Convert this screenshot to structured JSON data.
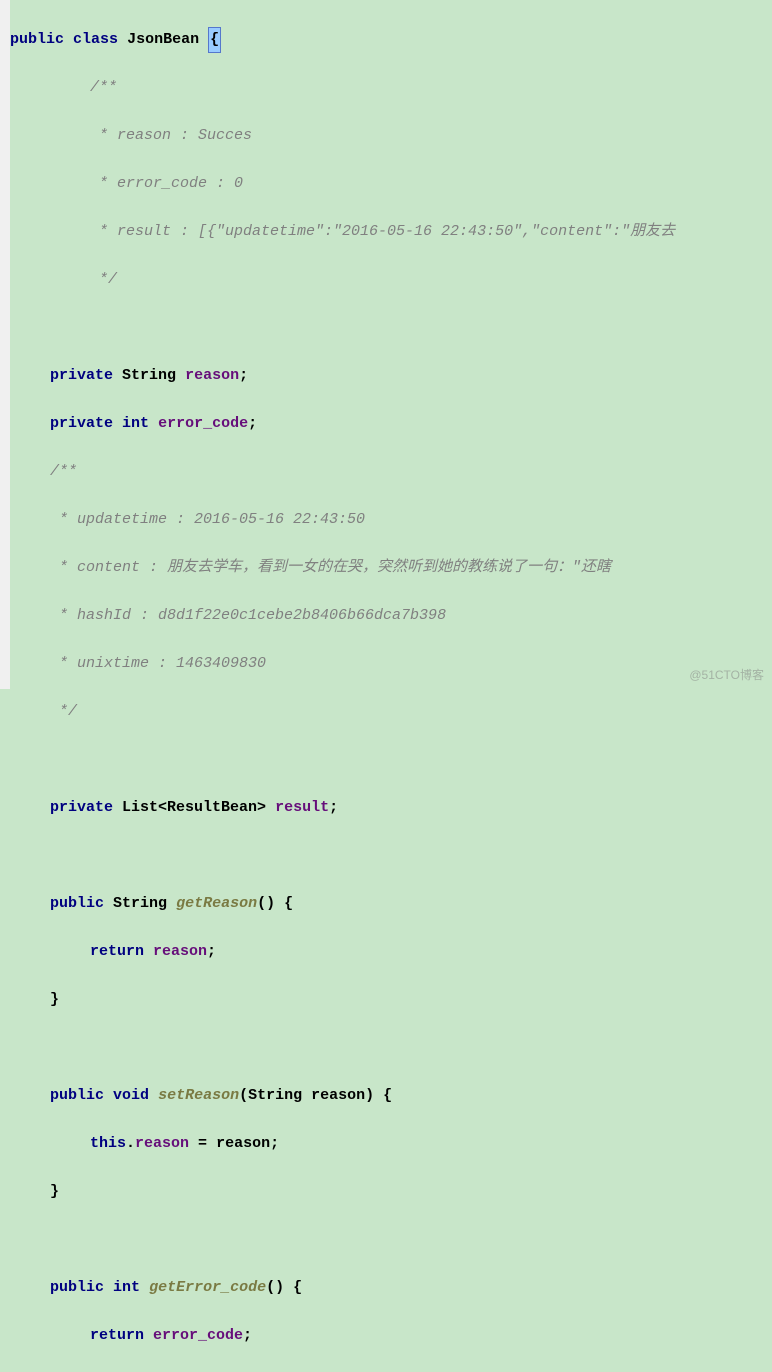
{
  "watermark": "@51CTO博客",
  "code": {
    "l1_public": "public",
    "l1_class": "class",
    "l1_name": "JsonBean",
    "l1_brace": "{",
    "l2": "/**",
    "l3": " * reason : Succes",
    "l4": " * error_code : 0",
    "l5": " * result : [{\"updatetime\":\"2016-05-16 22:43:50\",\"content\":\"朋友去",
    "l6": " */",
    "l8_private": "private",
    "l8_type": "String",
    "l8_name": "reason",
    "l8_semi": ";",
    "l9_private": "private",
    "l9_type": "int",
    "l9_name": "error_code",
    "l9_semi": ";",
    "l10": "/**",
    "l11": " * updatetime : 2016-05-16 22:43:50",
    "l12": " * content : 朋友去学车，看到一女的在哭，突然听到她的教练说了一句：\"还瞎",
    "l13": " * hashId : d8d1f22e0c1cebe2b8406b66dca7b398",
    "l14": " * unixtime : 1463409830",
    "l15": " */",
    "l17_private": "private",
    "l17_type": "List<ResultBean>",
    "l17_name": "result",
    "l17_semi": ";",
    "l19_public": "public",
    "l19_type": "String",
    "l19_method": "getReason",
    "l19_params": "()",
    "l19_brace": " {",
    "l20_return": "return",
    "l20_name": "reason",
    "l20_semi": ";",
    "l21_brace": "}",
    "l23_public": "public",
    "l23_type": "void",
    "l23_method": "setReason",
    "l23_params_open": "(",
    "l23_param_type": "String",
    "l23_param_name": " reason",
    "l23_params_close": ")",
    "l23_brace": " {",
    "l24_this": "this",
    "l24_dot": ".",
    "l24_name": "reason",
    "l24_eq": " = ",
    "l24_val": "reason;",
    "l25_brace": "}",
    "l27_public": "public",
    "l27_type": "int",
    "l27_method": "getError_code",
    "l27_params": "()",
    "l27_brace": " {",
    "l28_return": "return",
    "l28_name": "error_code",
    "l28_semi": ";"
  }
}
